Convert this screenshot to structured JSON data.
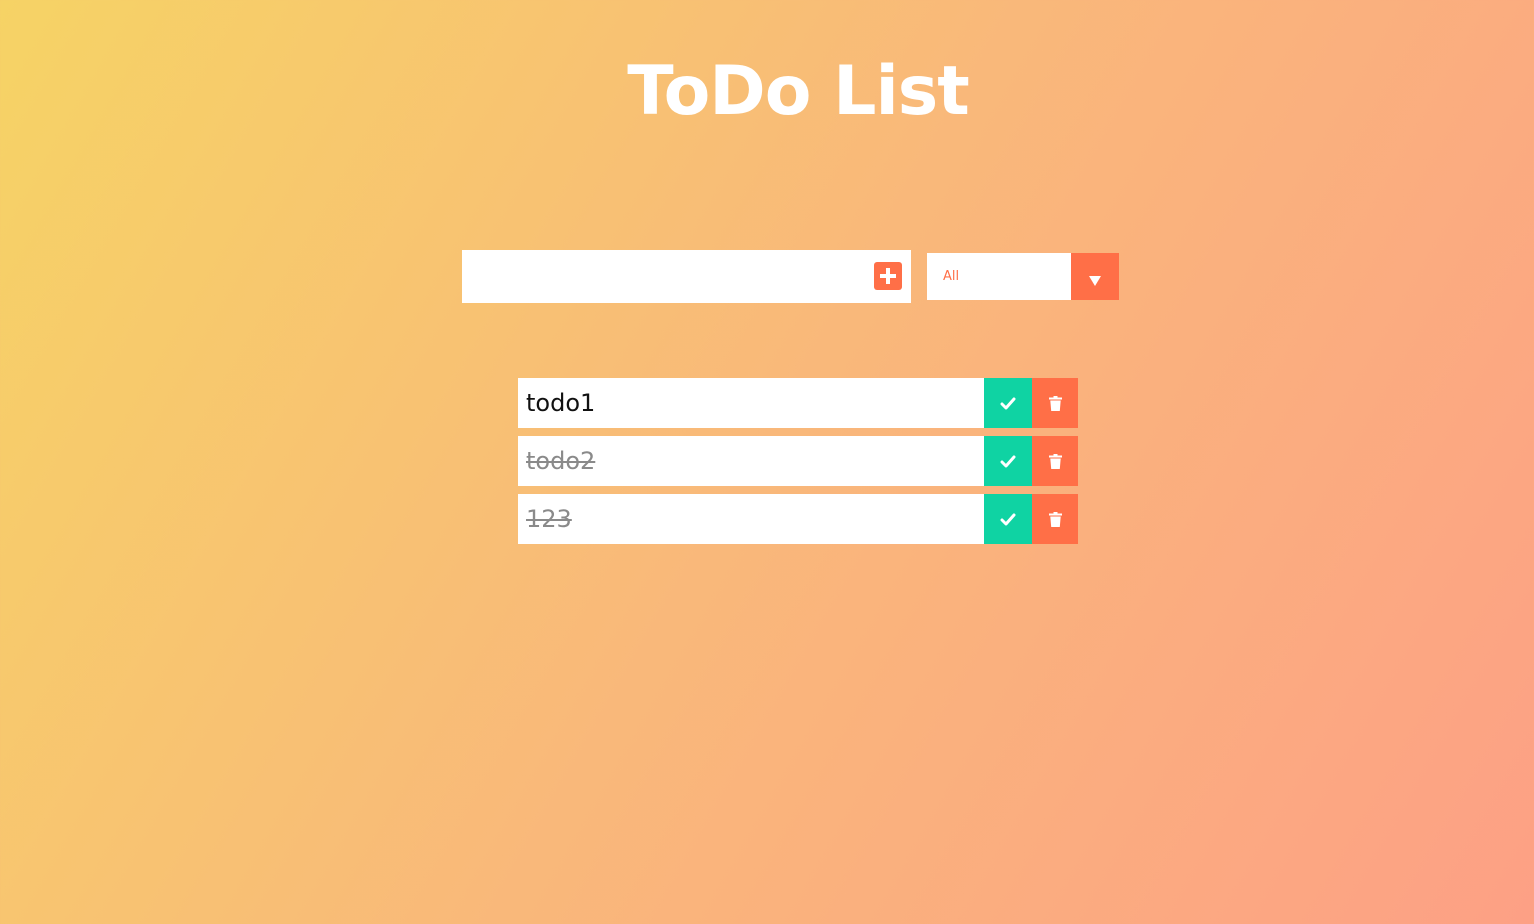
{
  "app": {
    "title": "ToDo List"
  },
  "form": {
    "input_value": "",
    "input_placeholder": "",
    "add_icon": "plus-square-icon"
  },
  "filter": {
    "selected": "All",
    "arrow_icon": "triangle-down-icon"
  },
  "todos": [
    {
      "text": "todo1",
      "completed": false
    },
    {
      "text": "todo2",
      "completed": true
    },
    {
      "text": "123",
      "completed": true
    }
  ],
  "icons": {
    "complete": "check-icon",
    "delete": "trash-icon"
  },
  "colors": {
    "accent": "#ff6f47",
    "complete": "#0fd3a3",
    "gradient_start": "#f6d365",
    "gradient_end": "#fda085"
  }
}
